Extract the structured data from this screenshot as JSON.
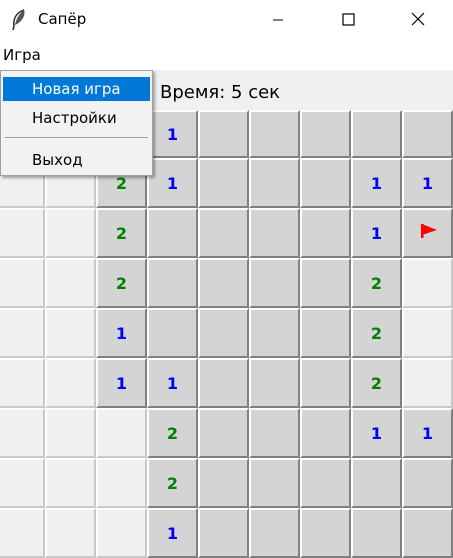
{
  "window": {
    "title": "Сапёр"
  },
  "menubar": {
    "game": "Игра"
  },
  "menu": {
    "items": [
      {
        "label": "Новая игра",
        "selected": true
      },
      {
        "label": "Настройки",
        "selected": false
      },
      {
        "label": "Выход",
        "selected": false
      }
    ]
  },
  "status": {
    "timer": "Время: 5 сек"
  },
  "board": {
    "rows": [
      [
        "?",
        "?",
        "?",
        "1",
        "#",
        "#",
        "#",
        "#",
        "#"
      ],
      [
        "",
        "",
        "2",
        "1",
        "#",
        "#",
        "#",
        "1",
        "1"
      ],
      [
        "",
        "",
        "2",
        "#",
        "#",
        "#",
        "#",
        "1",
        "F"
      ],
      [
        "",
        "",
        "2",
        "#",
        "#",
        "#",
        "#",
        "2",
        ""
      ],
      [
        "",
        "",
        "1",
        "#",
        "#",
        "#",
        "#",
        "2",
        ""
      ],
      [
        "",
        "",
        "1",
        "1",
        "#",
        "#",
        "#",
        "2",
        ""
      ],
      [
        "",
        "",
        "",
        "2",
        "#",
        "#",
        "#",
        "1",
        "1"
      ],
      [
        "",
        "",
        "",
        "2",
        "#",
        "#",
        "#",
        "#",
        "#"
      ],
      [
        "",
        "",
        "",
        "1",
        "#",
        "#",
        "#",
        "#",
        "#"
      ]
    ]
  },
  "colors": {
    "number_1": "#0000ff",
    "number_2": "#008000",
    "flag": "#ff0000",
    "menu_highlight": "#0078d7"
  }
}
